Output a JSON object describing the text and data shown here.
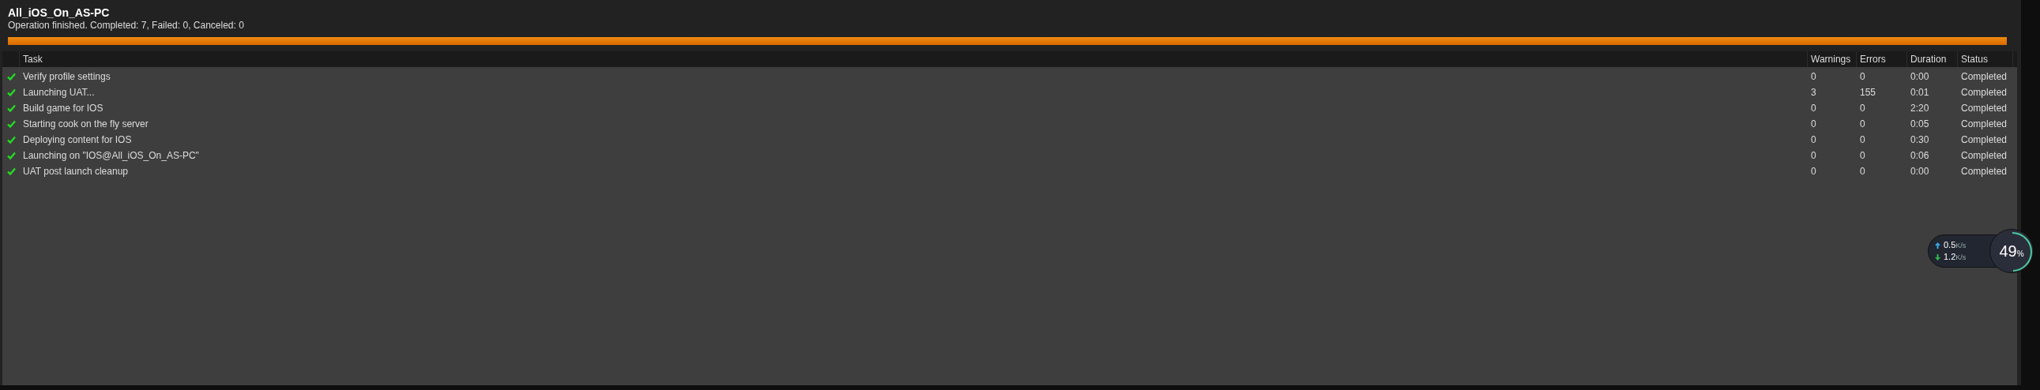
{
  "header": {
    "title": "All_iOS_On_AS-PC",
    "summary": "Operation finished. Completed: 7, Failed: 0, Canceled: 0",
    "progress": {
      "level": 1
    }
  },
  "table": {
    "columns": [
      "Task",
      "Warnings",
      "Errors",
      "Duration",
      "Status"
    ],
    "rows": [
      {
        "done": true,
        "task": "Verify profile settings",
        "warnings": "0",
        "errors": "0",
        "duration": "0:00",
        "status": "Completed"
      },
      {
        "done": true,
        "task": "Launching UAT...",
        "warnings": "3",
        "errors": "155",
        "duration": "0:01",
        "status": "Completed"
      },
      {
        "done": true,
        "task": "Build game for IOS",
        "warnings": "0",
        "errors": "0",
        "duration": "2:20",
        "status": "Completed"
      },
      {
        "done": true,
        "task": "Starting cook on the fly server",
        "warnings": "0",
        "errors": "0",
        "duration": "0:05",
        "status": "Completed"
      },
      {
        "done": true,
        "task": "Deploying content for IOS",
        "warnings": "0",
        "errors": "0",
        "duration": "0:30",
        "status": "Completed"
      },
      {
        "done": true,
        "task": "Launching on \"IOS@All_iOS_On_AS-PC\"",
        "warnings": "0",
        "errors": "0",
        "duration": "0:06",
        "status": "Completed"
      },
      {
        "done": true,
        "task": "UAT post launch cleanup",
        "warnings": "0",
        "errors": "0",
        "duration": "0:00",
        "status": "Completed"
      }
    ]
  },
  "net_widget": {
    "upload": "0.5",
    "upload_unit": "K/s",
    "download": "1.2",
    "download_unit": "K/s",
    "percent": "49",
    "percent_sign": "%"
  }
}
